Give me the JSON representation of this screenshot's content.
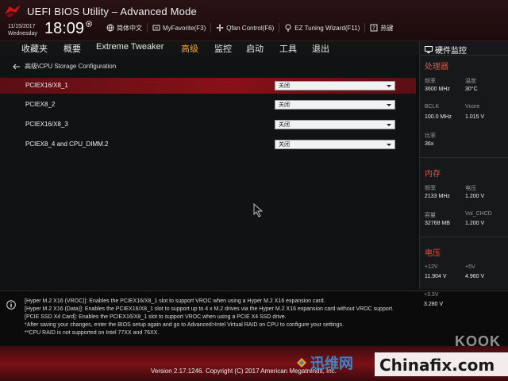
{
  "header": {
    "title": "UEFI BIOS Utility – Advanced Mode",
    "date": "11/15/2017",
    "weekday": "Wednesday",
    "time": "18:09",
    "tools": [
      {
        "label": "简体中文",
        "icon": "globe-icon"
      },
      {
        "label": "MyFavorite(F3)",
        "icon": "favorite-icon"
      },
      {
        "label": "Qfan Control(F6)",
        "icon": "fan-icon"
      },
      {
        "label": "EZ Tuning Wizard(F11)",
        "icon": "bulb-icon"
      },
      {
        "label": "热键",
        "icon": "question-icon"
      }
    ]
  },
  "nav": {
    "items": [
      "收藏夹",
      "概要",
      "Extreme Tweaker",
      "高级",
      "监控",
      "启动",
      "工具",
      "退出"
    ],
    "active_index": 3
  },
  "main": {
    "breadcrumb": "高级\\CPU Storage Configuration",
    "rows": [
      {
        "label": "PCIEX16/X8_1",
        "value": "关闭"
      },
      {
        "label": "PCIEX8_2",
        "value": "关闭"
      },
      {
        "label": "PCIEX16/X8_3",
        "value": "关闭"
      },
      {
        "label": "PCIEX8_4 and CPU_DIMM.2",
        "value": "关闭"
      }
    ]
  },
  "hw_monitor": {
    "title": "硬件监控",
    "cpu": {
      "title": "处理器",
      "freq_label": "频率",
      "freq": "3600 MHz",
      "temp_label": "温度",
      "temp": "30°C",
      "bclk_label": "BCLK",
      "bclk": "100.0 MHz",
      "vcore_label": "Vcore",
      "vcore": "1.015 V",
      "ratio_label": "比率",
      "ratio": "36x"
    },
    "memory": {
      "title": "内存",
      "freq_label": "频率",
      "freq": "2133 MHz",
      "volt_label": "电压",
      "volt": "1.200 V",
      "cap_label": "容量",
      "cap": "32768 MB",
      "vchcd_label": "Vol_CHCD",
      "vchcd": "1.200 V"
    },
    "voltage": {
      "title": "电压",
      "v12_label": "+12V",
      "v12": "11.904 V",
      "v5_label": "+5V",
      "v5": "4.960 V",
      "v33_label": "+3.3V",
      "v33": "3.280 V"
    }
  },
  "help": {
    "lines": [
      "[Hyper M.2 X16 (VROC)]: Enables the PCIEX16/X8_1 slot to support VROC when using a Hyper M.2 X16 expansion card.",
      "[Hyper M.2 X16 (Data)]: Enables the PCIEX16/X8_1 slot to support up to 4 x M.2 drives via the Hyper M.2 X16 expansion card without VROC support.",
      "[PCIE SSD X4 Card]: Enables the PCIEX16/X8_1 slot to support VROC when using a PCIE X4 SSD drive.",
      "*After saving your changes, enter the BIOS setup again and go to Advanced>Intel Virtual RAID on CPU to configure your settings.",
      "**CPU RAID is not supported on Intel 77XX and 76XX."
    ]
  },
  "footer": {
    "version": "Version 2.17.1246. Copyright (C) 2017 American Megatrends, Inc.",
    "watermark_cn": "迅维网",
    "watermark_en": "Chinafix.com",
    "watermark_corner": "KOOK"
  },
  "colors": {
    "accent": "#f5a623",
    "highlight_row": "#8a1018",
    "section_title": "#e0533f"
  }
}
